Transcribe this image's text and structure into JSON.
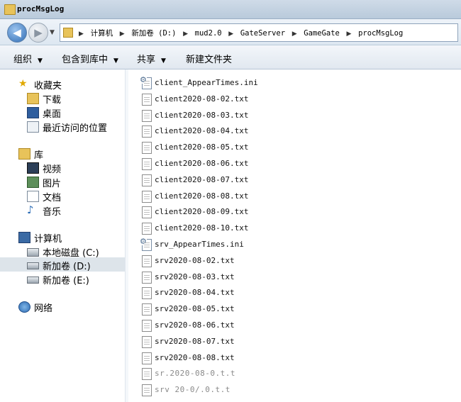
{
  "window": {
    "title": "procMsgLog"
  },
  "address": {
    "crumbs": [
      "计算机",
      "新加卷 (D:)",
      "mud2.0",
      "GateServer",
      "GameGate",
      "procMsgLog"
    ]
  },
  "toolbar": {
    "organize": "组织",
    "include_in_library": "包含到库中",
    "share": "共享",
    "new_folder": "新建文件夹"
  },
  "sidebar": {
    "favorites": {
      "label": "收藏夹",
      "items": [
        "下载",
        "桌面",
        "最近访问的位置"
      ]
    },
    "libraries": {
      "label": "库",
      "items": [
        "视频",
        "图片",
        "文档",
        "音乐"
      ]
    },
    "computer": {
      "label": "计算机",
      "items": [
        "本地磁盘 (C:)",
        "新加卷 (D:)",
        "新加卷 (E:)"
      ],
      "selected": "新加卷 (D:)"
    },
    "network": {
      "label": "网络"
    }
  },
  "files": [
    {
      "name": "client_AppearTimes.ini",
      "type": "ini"
    },
    {
      "name": "client2020-08-02.txt",
      "type": "txt"
    },
    {
      "name": "client2020-08-03.txt",
      "type": "txt"
    },
    {
      "name": "client2020-08-04.txt",
      "type": "txt"
    },
    {
      "name": "client2020-08-05.txt",
      "type": "txt"
    },
    {
      "name": "client2020-08-06.txt",
      "type": "txt"
    },
    {
      "name": "client2020-08-07.txt",
      "type": "txt"
    },
    {
      "name": "client2020-08-08.txt",
      "type": "txt"
    },
    {
      "name": "client2020-08-09.txt",
      "type": "txt"
    },
    {
      "name": "client2020-08-10.txt",
      "type": "txt"
    },
    {
      "name": "srv_AppearTimes.ini",
      "type": "ini"
    },
    {
      "name": "srv2020-08-02.txt",
      "type": "txt"
    },
    {
      "name": "srv2020-08-03.txt",
      "type": "txt"
    },
    {
      "name": "srv2020-08-04.txt",
      "type": "txt"
    },
    {
      "name": "srv2020-08-05.txt",
      "type": "txt"
    },
    {
      "name": "srv2020-08-06.txt",
      "type": "txt"
    },
    {
      "name": "srv2020-08-07.txt",
      "type": "txt"
    },
    {
      "name": "srv2020-08-08.txt",
      "type": "txt"
    },
    {
      "name": "sr.2020-08-0.t.t",
      "type": "txt",
      "faded": true
    },
    {
      "name": "srv 20-0/.0.t.t",
      "type": "txt",
      "faded": true
    }
  ],
  "colors": {
    "selection": "#dde4ea",
    "titlebar": "#cfdbe8",
    "toolbar": "#e1e8f0"
  }
}
